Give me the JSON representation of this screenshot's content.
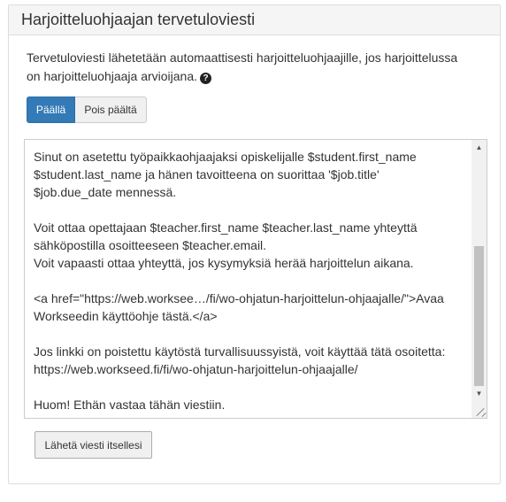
{
  "panel": {
    "title": "Harjoitteluohjaajan tervetuloviesti"
  },
  "intro": {
    "text": "Tervetuloviesti lähetetään automaattisesti harjoitteluohjaajille, jos harjoittelussa on harjoitteluohjaaja arvioijana."
  },
  "toggle": {
    "on_label": "Päällä",
    "off_label": "Pois päältä",
    "selected": "Päällä"
  },
  "message": {
    "body": "Sinut on asetettu työpaikkaohjaajaksi opiskelijalle $student.first_name\n$student.last_name ja hänen tavoitteena on suorittaa '$job.title'\n$job.due_date mennessä.\n\nVoit ottaa opettajaan $teacher.first_name $teacher.last_name yhteyttä\nsähköpostilla osoitteeseen $teacher.email.\nVoit vapaasti ottaa yhteyttä, jos kysymyksiä herää harjoittelun aikana.\n\n<a href=\"https://web.worksee…/fi/wo-ohjatun-harjoittelun-ohjaajalle/\">Avaa\nWorkseedin käyttöohje tästä.</a>\n\nJos linkki on poistettu käytöstä turvallisuussyistä, voit käyttää tätä osoitetta:\nhttps://web.workseed.fi/fi/wo-ohjatun-harjoittelun-ohjaajalle/\n\nHuom! Ethän vastaa tähän viestiin."
  },
  "actions": {
    "send_label": "Lähetä viesti itsellesi"
  }
}
